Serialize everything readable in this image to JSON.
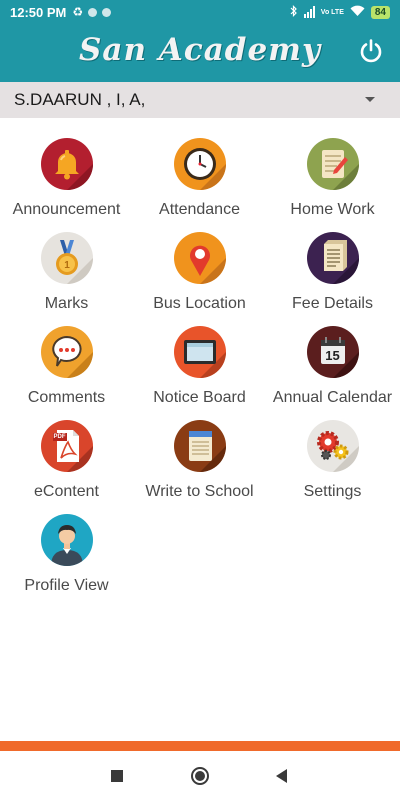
{
  "status_bar": {
    "time": "12:50 PM",
    "network": "Vo LTE",
    "battery": "84",
    "icons": [
      "sync-icon",
      "notification-dot-icon",
      "notification-dot-icon",
      "bluetooth-icon",
      "cell-signal-icon",
      "wifi-icon",
      "battery-icon"
    ]
  },
  "app_bar": {
    "title": "San Academy",
    "power_icon": "power-icon",
    "color": "#1f97a5"
  },
  "student_selector": {
    "value": "S.DAARUN , I, A,"
  },
  "menu": [
    {
      "label": "Announcement",
      "icon": "bell-icon"
    },
    {
      "label": "Attendance",
      "icon": "clock-icon"
    },
    {
      "label": "Home Work",
      "icon": "notepad-pencil-icon"
    },
    {
      "label": "Marks",
      "icon": "medal-icon"
    },
    {
      "label": "Bus Location",
      "icon": "map-pin-icon"
    },
    {
      "label": "Fee Details",
      "icon": "document-icon"
    },
    {
      "label": "Comments",
      "icon": "speech-bubble-icon"
    },
    {
      "label": "Notice Board",
      "icon": "board-icon"
    },
    {
      "label": "Annual Calendar",
      "icon": "calendar-icon",
      "day": "15"
    },
    {
      "label": "eContent",
      "icon": "pdf-icon",
      "badge": "PDF"
    },
    {
      "label": "Write to School",
      "icon": "notebook-icon"
    },
    {
      "label": "Settings",
      "icon": "gears-icon"
    },
    {
      "label": "Profile View",
      "icon": "user-avatar-icon"
    }
  ],
  "accent_color": "#f06a2b"
}
